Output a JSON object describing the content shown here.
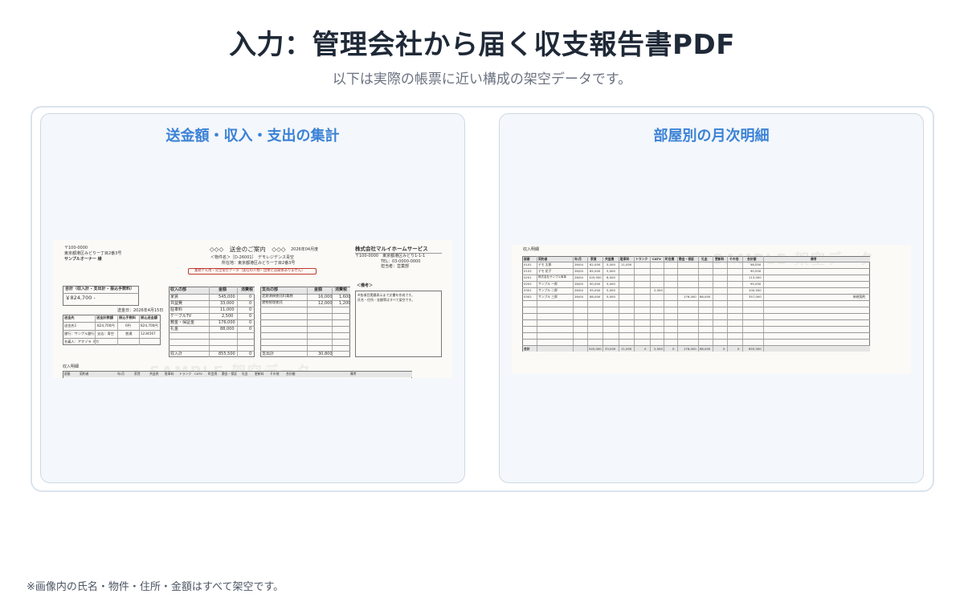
{
  "header": {
    "title": "入力：管理会社から届く収支報告書PDF",
    "subtitle": "以下は実際の帳票に近い構成の架空データです。"
  },
  "panels": {
    "left": {
      "title": "送金額・収入・支出の集計"
    },
    "right": {
      "title": "部屋別の月次明細"
    }
  },
  "doc_left": {
    "postal": "〒100-0000",
    "owner_address": "東京都港区みどり一丁目2番3号",
    "owner_name": "サンプルオーナー 様",
    "doc_title": "◇◇◇　送金のご案内　◇◇◇",
    "doc_date": "2026年04月度",
    "property_line": "＜物件名＞［D-26001］　デモレジデンス青空",
    "property_address": "所在地：東京都港区みどり一丁目2番3号",
    "notice": "業務デモ用・完全架空データ（実在の人物・団体とは関係ありません）",
    "company_name": "株式会社マルイホームサービス",
    "company_address": "〒100-0000　東京都港区みどり1-1-1",
    "company_tel": "TEL：03-0000-0000",
    "company_person": "担当者：営業部",
    "total_label": "合計（収入計 - 支出計 - 振込手数料）",
    "total_value": "￥824,700 -",
    "remit_date": "送金日：2026年4月15日",
    "remit_headers": [
      "送金先",
      "送金計数額",
      "振込手数料",
      "振込送金額"
    ],
    "remit_rows": [
      [
        "送金先1",
        "824,700円",
        "0円",
        "824,700円"
      ],
      [
        "銀行：サンプル銀行",
        "支店：青空",
        "普通",
        "1234567"
      ],
      [
        "名義人：アオゾラ ミカ",
        "",
        "",
        ""
      ]
    ],
    "income_headers": [
      "収入の部",
      "金額",
      "消費税"
    ],
    "income_rows": [
      [
        "家賃",
        "545,000",
        "0"
      ],
      [
        "共益費",
        "33,000",
        "0"
      ],
      [
        "駐車料",
        "11,000",
        "0"
      ],
      [
        "ケーブルTV",
        "2,500",
        "0"
      ],
      [
        "敷金・保証金",
        "176,000",
        "0"
      ],
      [
        "礼金",
        "88,000",
        "0"
      ]
    ],
    "income_total_label": "収入計",
    "income_total": "855,500",
    "income_total_tax": "0",
    "expense_headers": [
      "支出の部",
      "金額",
      "消費税"
    ],
    "expense_rows": [
      [
        "定期清掃委託料業務",
        "16,000",
        "1,600"
      ],
      [
        "建物管理委託",
        "12,000",
        "1,200"
      ]
    ],
    "expense_total_label": "支出計",
    "expense_total": "30,800",
    "memo_label": "＜備考＞",
    "memo_lines": [
      "※各項目実績表示まで文書を作成です。",
      "氏名・住所・金額等はすべて架空です。"
    ],
    "detail_label": "収入明細",
    "detail_headers": [
      "部屋",
      "契約者",
      "年/月",
      "家賃",
      "共益費",
      "駐車料",
      "トランク",
      "CATV",
      "町会費",
      "敷金・保証",
      "礼金",
      "更新料",
      "その他",
      "合計額",
      "備考"
    ],
    "watermark": "SAMPLE 架空データ"
  },
  "doc_right": {
    "label": "収入明細",
    "headers": [
      "部屋",
      "契約者",
      "年/月",
      "家賃",
      "共益費",
      "駐車料",
      "トランク",
      "CATV",
      "町会費",
      "敷金・保証",
      "礼金",
      "更新料",
      "その他",
      "合計額",
      "備考"
    ],
    "rows": [
      [
        "0101",
        "デモ 太郎",
        "26/04",
        "82,000",
        "5,000",
        "11,000",
        "",
        "",
        "",
        "",
        "",
        "",
        "",
        "98,000",
        ""
      ],
      [
        "0102",
        "デモ 花子",
        "26/04",
        "85,000",
        "5,000",
        "",
        "",
        "",
        "",
        "",
        "",
        "",
        "",
        "90,000",
        ""
      ],
      [
        "0201",
        "株式会社サンプル商事",
        "26/04",
        "105,000",
        "8,000",
        "",
        "",
        "",
        "",
        "",
        "",
        "",
        "",
        "113,000",
        ""
      ],
      [
        "0202",
        "サンプル 一郎",
        "26/04",
        "90,000",
        "5,000",
        "",
        "",
        "",
        "",
        "",
        "",
        "",
        "",
        "95,000",
        ""
      ],
      [
        "0301",
        "サンプル 二郎",
        "26/04",
        "95,000",
        "5,000",
        "",
        "",
        "2,500",
        "",
        "",
        "",
        "",
        "",
        "100,500",
        ""
      ],
      [
        "0302",
        "サンプル 三郎",
        "26/04",
        "88,000",
        "5,000",
        "",
        "",
        "",
        "",
        "176,000",
        "88,000",
        "",
        "",
        "357,000",
        "新規契約"
      ]
    ],
    "totals": [
      "合計",
      "",
      "",
      "545,000",
      "33,000",
      "11,000",
      "0",
      "2,500",
      "0",
      "176,000",
      "88,000",
      "0",
      "0",
      "855,500",
      ""
    ],
    "watermark": "SAMPLE 架空データ"
  },
  "footnote": "※画像内の氏名・物件・住所・金額はすべて架空です。"
}
